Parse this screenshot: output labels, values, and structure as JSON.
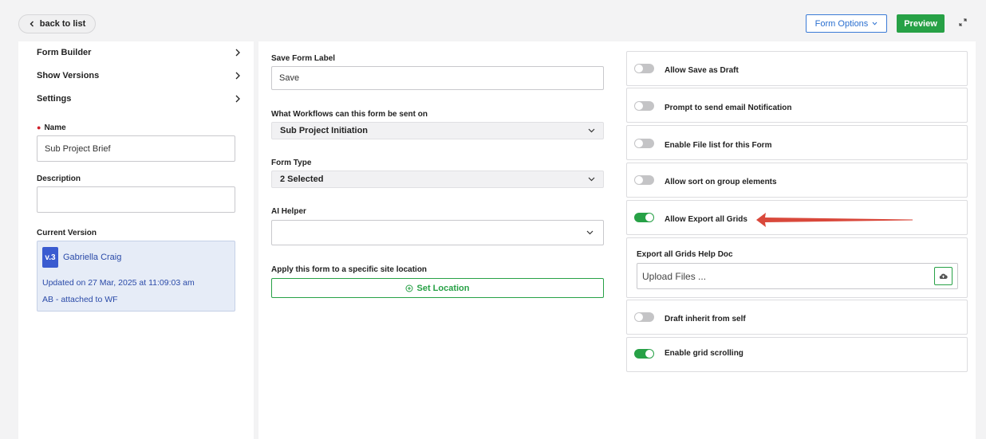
{
  "header": {
    "back_label": "back to list",
    "form_options_label": "Form Options",
    "preview_label": "Preview"
  },
  "sidebar": {
    "nav": [
      {
        "label": "Form Builder"
      },
      {
        "label": "Show Versions"
      },
      {
        "label": "Settings"
      }
    ],
    "name_label": "Name",
    "name_value": "Sub Project Brief",
    "description_label": "Description",
    "description_value": "",
    "current_version_label": "Current Version",
    "version": {
      "badge": "v.3",
      "user": "Gabriella Craig",
      "updated": "Updated on 27 Mar, 2025 at 11:09:03 am",
      "note": "AB - attached to WF"
    }
  },
  "middle": {
    "save_label_title": "Save Form Label",
    "save_label_value": "Save",
    "workflows_title": "What Workflows can this form be sent on",
    "workflows_value": "Sub Project Initiation",
    "form_type_title": "Form Type",
    "form_type_value": "2 Selected",
    "ai_helper_title": "AI Helper",
    "apply_title": "Apply this form to a specific site location",
    "set_location_label": "Set Location"
  },
  "settings": {
    "toggles": [
      {
        "label": "Allow Save as Draft",
        "on": false
      },
      {
        "label": "Prompt to send email Notification",
        "on": false
      },
      {
        "label": "Enable File list for this Form",
        "on": false
      },
      {
        "label": "Allow sort on group elements",
        "on": false
      },
      {
        "label": "Allow Export all Grids",
        "on": true
      },
      {
        "label": "Draft inherit from self",
        "on": false
      },
      {
        "label": "Enable grid scrolling",
        "on": true
      }
    ],
    "export_help_title": "Export all Grids Help Doc",
    "upload_placeholder": "Upload Files ..."
  },
  "colors": {
    "accent_green": "#27a146",
    "accent_blue": "#2a6fd0",
    "annotation_red": "#d9483b"
  }
}
